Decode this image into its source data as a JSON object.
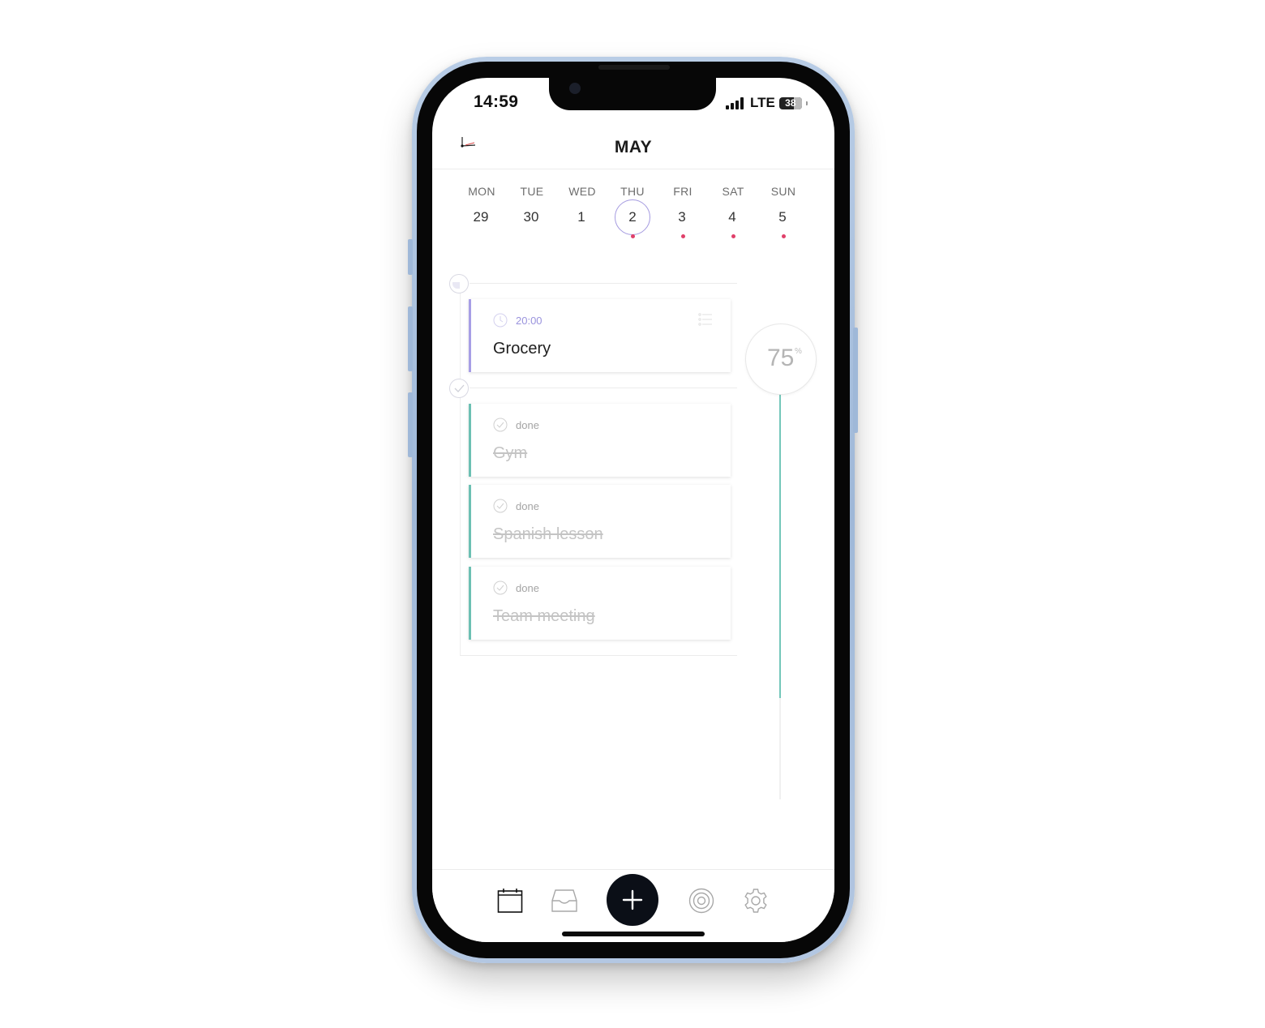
{
  "status_bar": {
    "time": "14:59",
    "network": "LTE",
    "battery": "38"
  },
  "header": {
    "title": "MAY",
    "logo_icon": "app-logo-icon"
  },
  "week": {
    "days": [
      {
        "name": "MON",
        "num": "29",
        "selected": false,
        "has_tasks": false
      },
      {
        "name": "TUE",
        "num": "30",
        "selected": false,
        "has_tasks": false
      },
      {
        "name": "WED",
        "num": "1",
        "selected": false,
        "has_tasks": false
      },
      {
        "name": "THU",
        "num": "2",
        "selected": true,
        "has_tasks": true
      },
      {
        "name": "FRI",
        "num": "3",
        "selected": false,
        "has_tasks": true
      },
      {
        "name": "SAT",
        "num": "4",
        "selected": false,
        "has_tasks": true
      },
      {
        "name": "SUN",
        "num": "5",
        "selected": false,
        "has_tasks": true
      }
    ],
    "selected_color": "#a59be0",
    "dot_color": "#e0406a"
  },
  "tasks": {
    "pending": [
      {
        "time": "20:00",
        "title": "Grocery",
        "accent": "#a79ee6"
      }
    ],
    "done": [
      {
        "status": "done",
        "title": "Gym"
      },
      {
        "status": "done",
        "title": "Spanish lesson"
      },
      {
        "status": "done",
        "title": "Team meeting"
      }
    ],
    "done_accent": "#6cc0b3"
  },
  "progress": {
    "value": "75",
    "unit": "%",
    "fraction": 0.75,
    "color": "#74c7ba"
  },
  "nav": {
    "items": [
      "calendar-icon",
      "inbox-icon",
      "add-icon",
      "goal-target-icon",
      "settings-gear-icon"
    ]
  }
}
